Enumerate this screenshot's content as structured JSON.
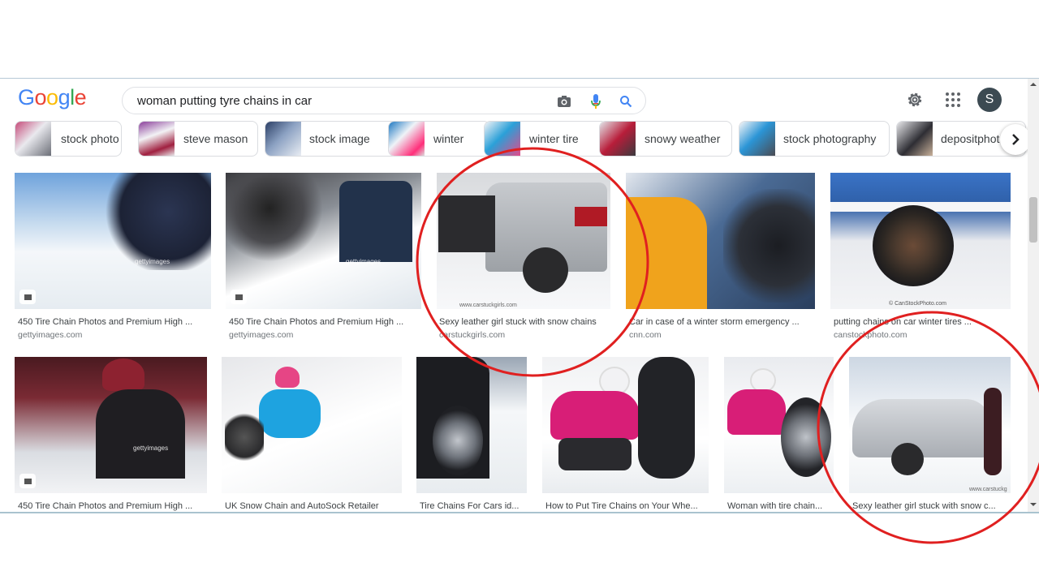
{
  "search": {
    "query": "woman putting tyre chains in car",
    "logo_letters": [
      {
        "ch": "G",
        "color": "#4285f4"
      },
      {
        "ch": "o",
        "color": "#ea4335"
      },
      {
        "ch": "o",
        "color": "#fbbc05"
      },
      {
        "ch": "g",
        "color": "#4285f4"
      },
      {
        "ch": "l",
        "color": "#34a853"
      },
      {
        "ch": "e",
        "color": "#ea4335"
      }
    ],
    "camera_icon": "camera-icon",
    "mic_icon": "mic-icon",
    "search_icon": "search-icon"
  },
  "header": {
    "settings_icon": "gear-icon",
    "apps_icon": "apps-grid-icon",
    "avatar_letter": "S"
  },
  "chips": [
    {
      "label": "stock photo"
    },
    {
      "label": "steve mason"
    },
    {
      "label": "stock image"
    },
    {
      "label": "winter"
    },
    {
      "label": "winter tire"
    },
    {
      "label": "snowy weather"
    },
    {
      "label": "stock photography"
    },
    {
      "label": "depositphot"
    }
  ],
  "results_row1": [
    {
      "caption": "450 Tire Chain Photos and Premium High ...",
      "source": "gettyimages.com",
      "watermark": "gettyimages"
    },
    {
      "caption": "450 Tire Chain Photos and Premium High ...",
      "source": "gettyimages.com",
      "watermark": "gettyimages"
    },
    {
      "caption": "Sexy leather girl stuck with snow chains",
      "source": "carstuckgirls.com",
      "watermark": "www.carstuckgirls.com"
    },
    {
      "caption": "Car in case of a winter storm emergency ...",
      "source": "cnn.com",
      "watermark": ""
    },
    {
      "caption": "putting chains on car winter tires ...",
      "source": "canstockphoto.com",
      "watermark": "© CanStockPhoto.com"
    }
  ],
  "results_row2": [
    {
      "caption": "450 Tire Chain Photos and Premium High ...",
      "watermark": "gettyimages"
    },
    {
      "caption": "UK Snow Chain and AutoSock Retailer",
      "watermark": ""
    },
    {
      "caption": "Tire Chains For Cars id...",
      "watermark": ""
    },
    {
      "caption": "How to Put Tire Chains on Your Whe...",
      "watermark": ""
    },
    {
      "caption": "Woman with tire chain...",
      "watermark": ""
    },
    {
      "caption": "Sexy leather girl stuck with snow c...",
      "watermark": "www.carstuckg"
    }
  ],
  "annotation": {
    "circle_color": "#e02020"
  }
}
